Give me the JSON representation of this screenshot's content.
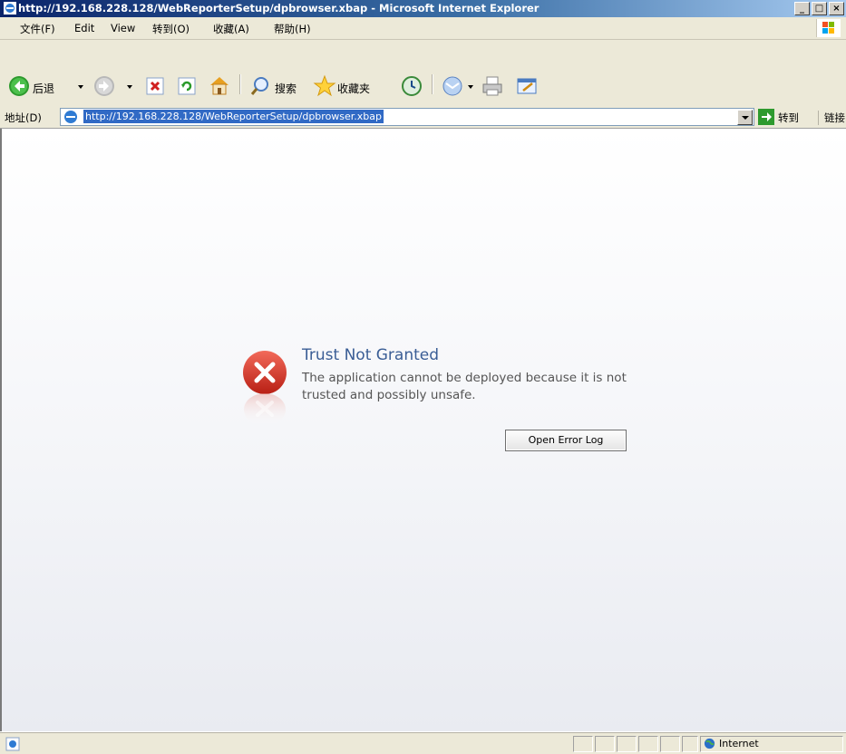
{
  "window": {
    "title": "http://192.168.228.128/WebReporterSetup/dpbrowser.xbap - Microsoft Internet Explorer",
    "buttons": {
      "minimize": "_",
      "maximize": "□",
      "close": "×"
    }
  },
  "menu": {
    "items": [
      "文件(F)",
      "Edit",
      "View",
      "转到(O)",
      "收藏(A)",
      "帮助(H)"
    ]
  },
  "toolbar": {
    "back_label": "后退",
    "search_label": "搜索",
    "favorites_label": "收藏夹"
  },
  "address": {
    "label": "地址(D)",
    "url": "http://192.168.228.128/WebReporterSetup/dpbrowser.xbap",
    "go_label": "转到",
    "links_label": "链接"
  },
  "error": {
    "title": "Trust Not Granted",
    "message": "The application cannot be deployed because it is not trusted and possibly unsafe.",
    "button_label": "Open Error Log"
  },
  "status": {
    "zone_label": "Internet"
  },
  "colors": {
    "title_gradient_start": "#0a246a",
    "chrome": "#ece9d8",
    "error_title": "#3a5d95",
    "error_icon": "#cc2a1f",
    "url_highlight": "#316ac5"
  }
}
